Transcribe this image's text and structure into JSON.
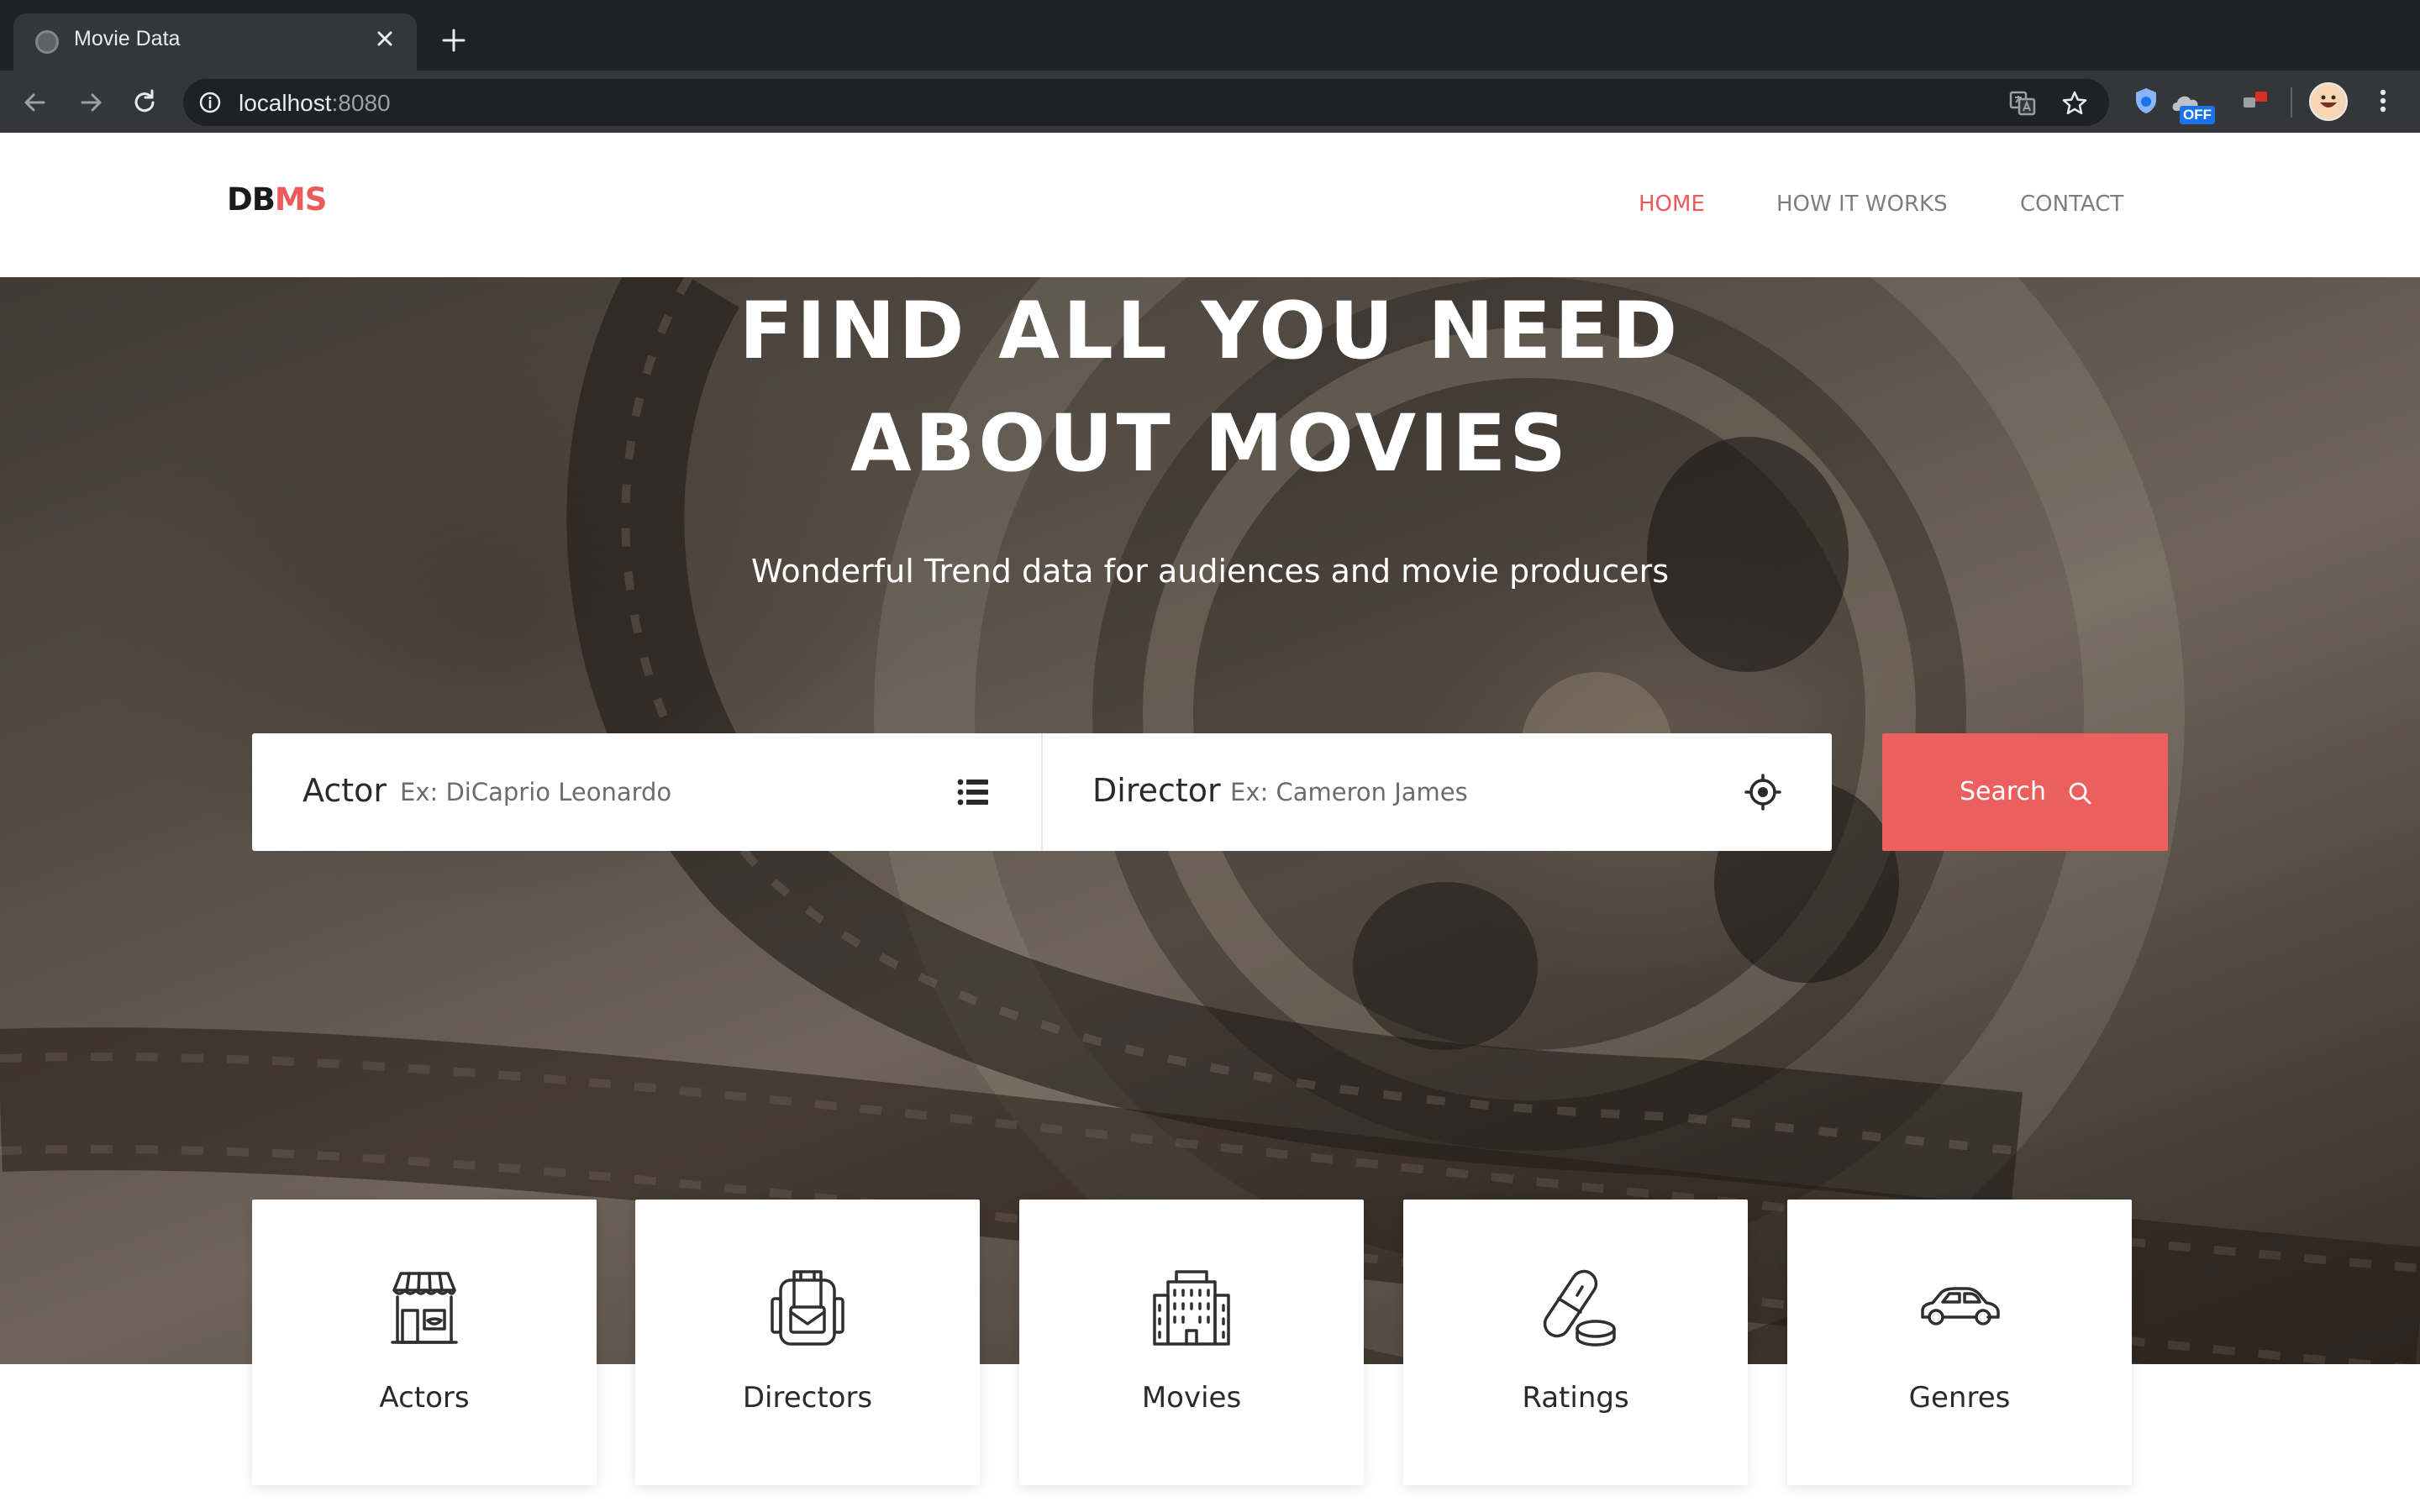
{
  "browser": {
    "tab_title": "Movie Data",
    "url_host": "localhost",
    "url_port": ":8080",
    "extension_badge": "OFF",
    "icons": [
      "globe-icon",
      "close-icon",
      "plus-icon",
      "back-icon",
      "forward-icon",
      "reload-icon",
      "info-icon",
      "translate-icon",
      "star-icon",
      "menu-dots-icon"
    ]
  },
  "site": {
    "logo_part1": "DB",
    "logo_part2": "MS",
    "nav": [
      {
        "label": "HOME",
        "active": true
      },
      {
        "label": "HOW IT WORKS",
        "active": false
      },
      {
        "label": "CONTACT",
        "active": false
      }
    ]
  },
  "hero": {
    "title_line1": "FIND ALL YOU NEED",
    "title_line2": "ABOUT MOVIES",
    "subtitle": "Wonderful Trend data for audiences and movie producers"
  },
  "search": {
    "actor_label": "Actor",
    "actor_placeholder": "Ex: DiCaprio Leonardo",
    "director_label": "Director",
    "director_placeholder": "Ex: Cameron James",
    "button_label": "Search"
  },
  "categories": [
    {
      "label": "Actors",
      "icon": "storefront-icon"
    },
    {
      "label": "Directors",
      "icon": "backpack-icon"
    },
    {
      "label": "Movies",
      "icon": "building-icon"
    },
    {
      "label": "Ratings",
      "icon": "pill-icon"
    },
    {
      "label": "Genres",
      "icon": "car-icon"
    }
  ],
  "colors": {
    "accent": "#ec5a5a",
    "nav_text": "#7a7f86",
    "chrome_dark": "#202124",
    "chrome_toolbar": "#35363a"
  }
}
